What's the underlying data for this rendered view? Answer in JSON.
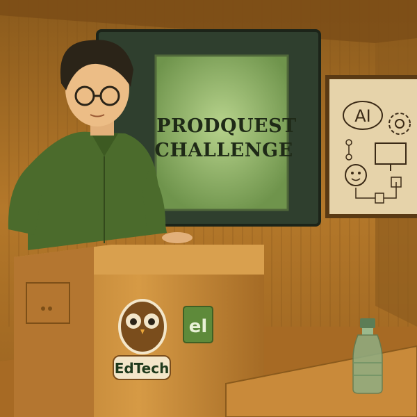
{
  "scene": {
    "description_text": "",
    "screen": {
      "title_line1": "PRODQUEST",
      "title_line2": "CHALLENGE"
    },
    "poster": {
      "label": "AI"
    },
    "podium": {
      "owl_badge_text": "EdTech",
      "logo_text": "el"
    }
  },
  "colors": {
    "wall": "#b97a2a",
    "screen_green": "#8fb56a",
    "shirt_green": "#4b6b2c",
    "podium": "#c98a3a"
  }
}
